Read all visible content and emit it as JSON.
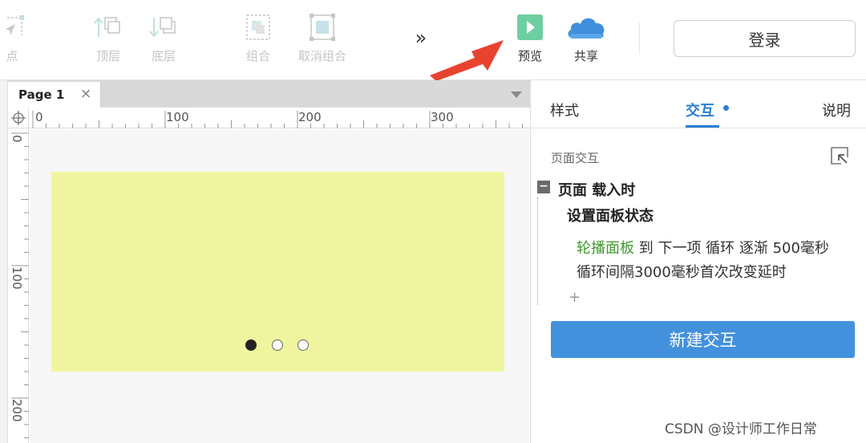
{
  "toolbar": {
    "items": [
      {
        "label": "点",
        "icon": "point-icon"
      },
      {
        "label": "顶层",
        "icon": "bring-to-front-icon"
      },
      {
        "label": "底层",
        "icon": "send-to-back-icon"
      },
      {
        "label": "组合",
        "icon": "group-icon"
      },
      {
        "label": "取消组合",
        "icon": "ungroup-icon"
      },
      {
        "label": "预览",
        "icon": "play-icon"
      },
      {
        "label": "共享",
        "icon": "cloud-icon"
      }
    ],
    "more": "»",
    "login": "登录"
  },
  "colors": {
    "accent": "#2a7fd4",
    "preview_green": "#6dcfa0",
    "panel_yellow": "#eff59e",
    "button_blue": "#4391dd",
    "arrow_red": "#e8432f"
  },
  "page_tabs": {
    "tab": "Page 1",
    "close": "×"
  },
  "ruler": {
    "h_labels": [
      "0",
      "100",
      "200",
      "300"
    ],
    "v_labels": [
      "0",
      "100",
      "200"
    ]
  },
  "carousel": {
    "dots": [
      "active",
      "inactive",
      "inactive"
    ]
  },
  "right_panel": {
    "tabs": [
      "样式",
      "交互",
      "说明"
    ],
    "active_tab": "交互",
    "section_title": "页面交互",
    "collapse": "−",
    "event": "页面 载入时",
    "action": "设置面板状态",
    "target": "轮播面板",
    "detail_line1_rest": " 到 下一项 循环 逐渐 500毫秒",
    "detail_line2": "循环间隔3000毫秒首次改变延时",
    "add": "+",
    "new_button": "新建交互"
  },
  "watermark": "CSDN @设计师工作日常"
}
